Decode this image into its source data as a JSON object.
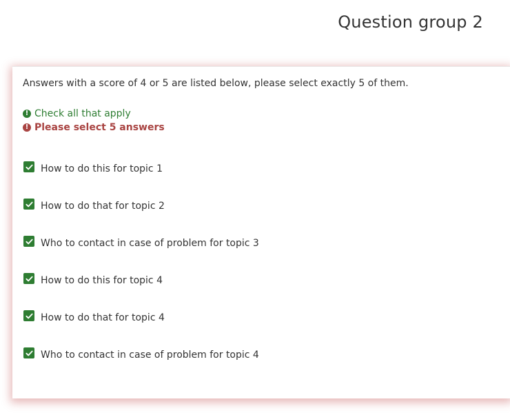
{
  "group_title": "Question group 2",
  "question": {
    "text": "Answers with a score of 4 or 5 are listed below, please select exactly 5 of them.",
    "tip_info": "Check all that apply",
    "tip_error": "Please select 5 answers"
  },
  "answers": [
    {
      "label": "How to do this for topic 1",
      "checked": true
    },
    {
      "label": "How to do that for topic 2",
      "checked": true
    },
    {
      "label": "Who to contact in case of problem for topic 3",
      "checked": true
    },
    {
      "label": "How to do this for topic 4",
      "checked": true
    },
    {
      "label": "How to do that for topic 4",
      "checked": true
    },
    {
      "label": "Who to contact in case of problem for topic 4",
      "checked": true
    }
  ],
  "icons": {
    "info": "exclamation-circle-icon",
    "error": "exclamation-circle-icon",
    "check": "checkmark-icon"
  },
  "colors": {
    "checkbox": "#2e7d32",
    "info_tip": "#2e7d32",
    "error_tip": "#a94442",
    "card_shadow": "#c04848"
  }
}
